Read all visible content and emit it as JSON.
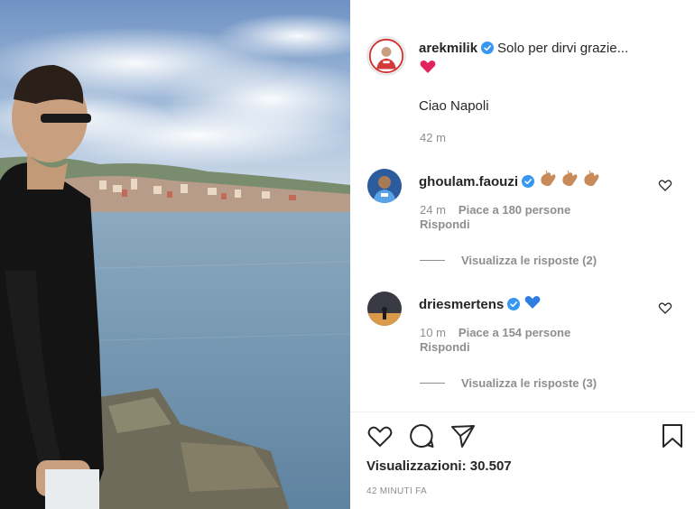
{
  "post": {
    "author_username": "arekmilik",
    "caption_text": "Solo per dirvi grazie...",
    "caption_emoji": "red-heart",
    "caption_line2": "Ciao Napoli",
    "caption_time": "42 m"
  },
  "comments": [
    {
      "username": "ghoulam.faouzi",
      "emoji": "clapping-hands x3",
      "time": "24 m",
      "likes": "Piace a 180 persone",
      "reply_label": "Rispondi",
      "view_replies": "Visualizza le risposte (2)"
    },
    {
      "username": "driesmertens",
      "emoji": "blue-heart",
      "time": "10 m",
      "likes": "Piace a 154 persone",
      "reply_label": "Rispondi",
      "view_replies": "Visualizza le risposte (3)"
    }
  ],
  "footer": {
    "views": "Visualizzazioni: 30.507",
    "timestamp": "42 MINUTI FA"
  },
  "icons": {
    "like": "heart-outline-icon",
    "comment": "comment-bubble-icon",
    "share": "paper-plane-icon",
    "save": "bookmark-icon",
    "verified": "verified-badge-icon"
  },
  "colors": {
    "verified_blue": "#3897f0",
    "text_primary": "#262626",
    "text_secondary": "#8e8e8e",
    "heart_red": "#e0245e",
    "heart_blue": "#2f7de1"
  }
}
